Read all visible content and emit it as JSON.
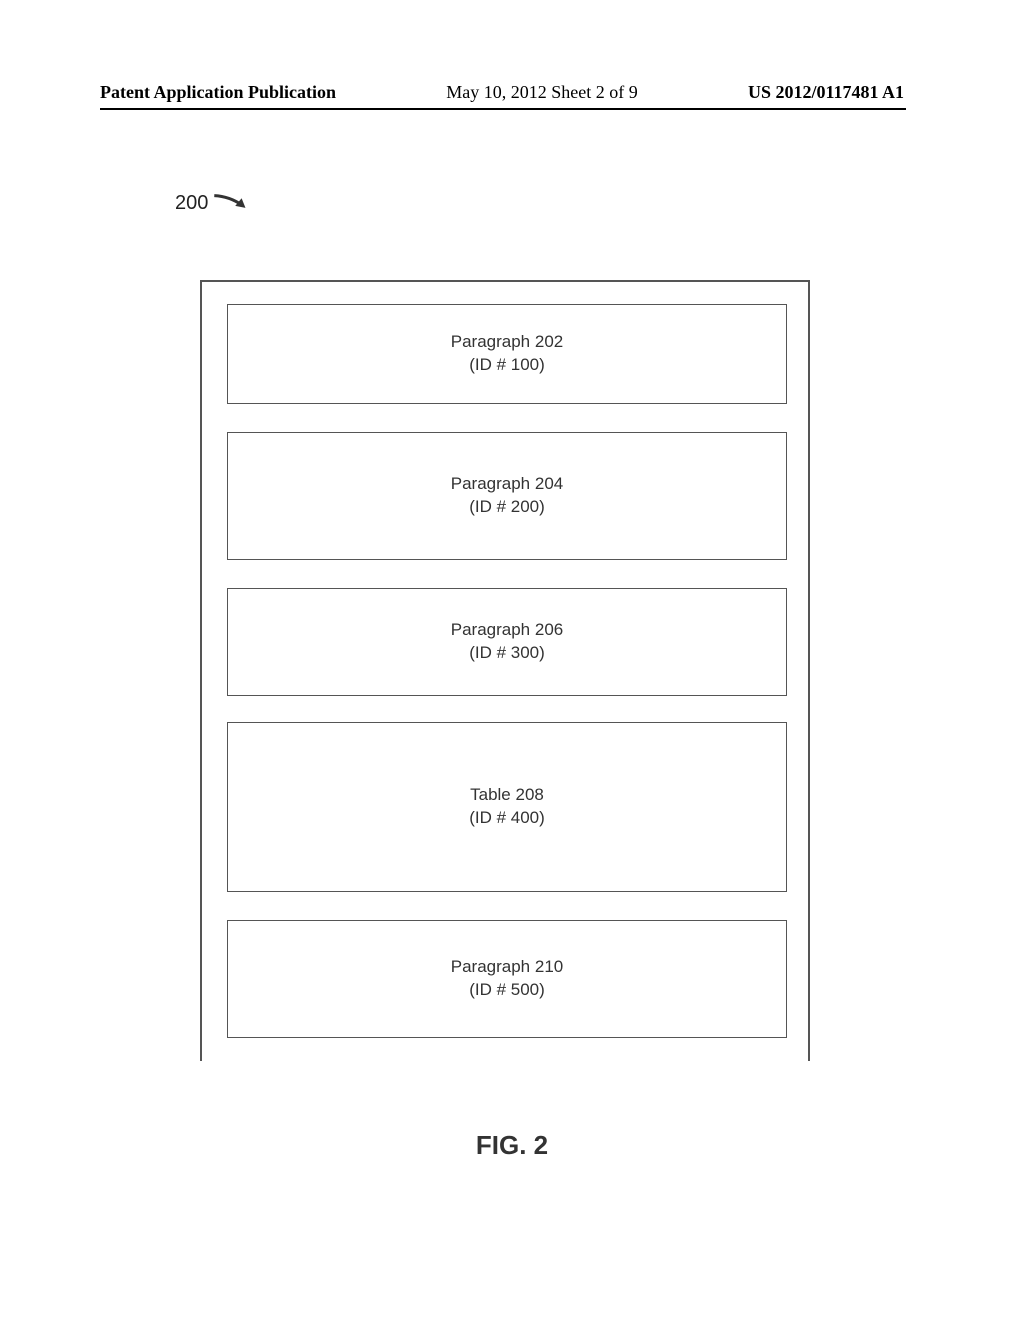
{
  "header": {
    "left": "Patent Application Publication",
    "center": "May 10, 2012  Sheet 2 of 9",
    "right": "US 2012/0117481 A1"
  },
  "reference_label": "200",
  "boxes": [
    {
      "line1": "Paragraph 202",
      "line2": "(ID # 100)"
    },
    {
      "line1": "Paragraph 204",
      "line2": "(ID # 200)"
    },
    {
      "line1": "Paragraph 206",
      "line2": "(ID # 300)"
    },
    {
      "line1": "Table 208",
      "line2": "(ID # 400)"
    },
    {
      "line1": "Paragraph 210",
      "line2": "(ID # 500)"
    }
  ],
  "figure_caption": "FIG. 2"
}
